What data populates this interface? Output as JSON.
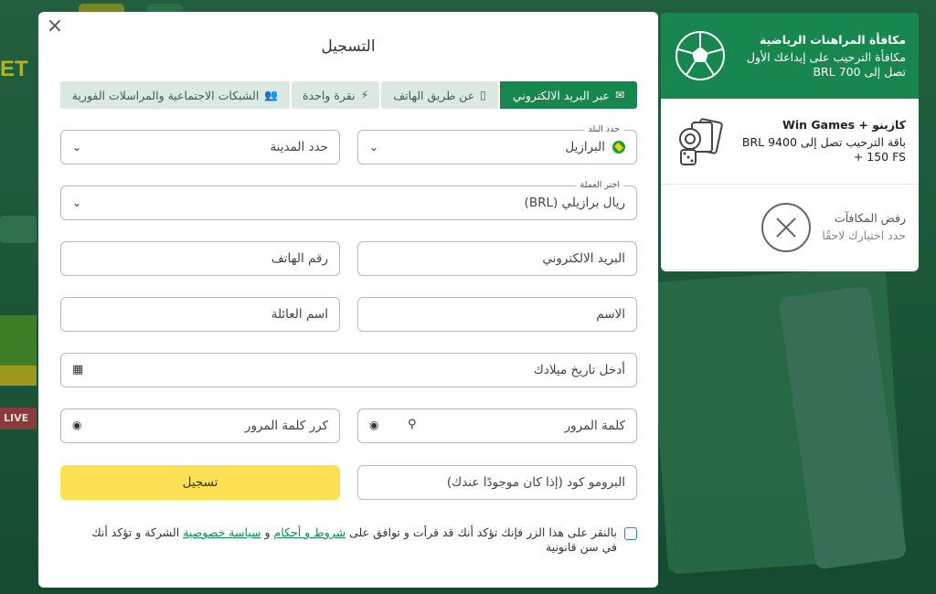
{
  "modal": {
    "title": "التسجيل",
    "close_icon": "×"
  },
  "tabs": [
    {
      "label": "عبر البريد الالكتروني",
      "icon": "envelope-icon",
      "glyph": "✉",
      "active": true
    },
    {
      "label": "عن طريق الهاتف",
      "icon": "phone-icon",
      "glyph": "▯",
      "active": false
    },
    {
      "label": "نقرة واحدة",
      "icon": "bolt-icon",
      "glyph": "⚡",
      "active": false
    },
    {
      "label": "الشبكات الاجتماعية والمراسلات الفورية",
      "icon": "users-icon",
      "glyph": "👥",
      "active": false
    }
  ],
  "form": {
    "country_label": "حدد البلد",
    "country_value": "البرازيل",
    "city_placeholder": "حدد المدينة",
    "currency_label": "اختر العملة",
    "currency_value": "ريال برازيلي (BRL)",
    "email_placeholder": "البريد الالكتروني",
    "phone_placeholder": "رقم الهاتف",
    "first_name_placeholder": "الاسم",
    "last_name_placeholder": "اسم العائلة",
    "birthdate_placeholder": "أدخل تاريخ ميلادك",
    "password_placeholder": "كلمة المرور",
    "repeat_password_placeholder": "كرر كلمة المرور",
    "promo_placeholder": "البرومو كود (إذا كان موجودًا عندك)",
    "submit_label": "تسجيل"
  },
  "consent": {
    "text_before": "بالنقر على هذا الزر فإنك تؤكد أنك قد قرأت و توافق على ",
    "terms_link": "شروط و أحكام",
    "and": " و ",
    "privacy_link": "سياسة خصوصية",
    "text_after": " الشركة و تؤكد أنك في سن قانونية"
  },
  "bonuses": [
    {
      "title": "مكافأة المراهنات الرياضية",
      "desc": "مكافأة الترحيب على إيداعك الأول تصل إلى 700 BRL",
      "icon": "soccer-ball-icon",
      "active": true
    },
    {
      "title": "كازينو + Win Games",
      "desc": "باقة الترحيب تصل إلى 9400 BRL + 150 FS",
      "icon": "casino-cards-dice-icon",
      "active": false
    },
    {
      "title": "رفض المكافآت",
      "desc": "حدد اختيارك لاحقًا",
      "icon": "close-circle-icon",
      "active": false
    }
  ],
  "background": {
    "live_badge": "LIVE",
    "logo_fragment": "ET"
  },
  "colors": {
    "accent_green": "#17864f",
    "submit_yellow": "#fde053",
    "tab_inactive": "#dce9e3"
  }
}
